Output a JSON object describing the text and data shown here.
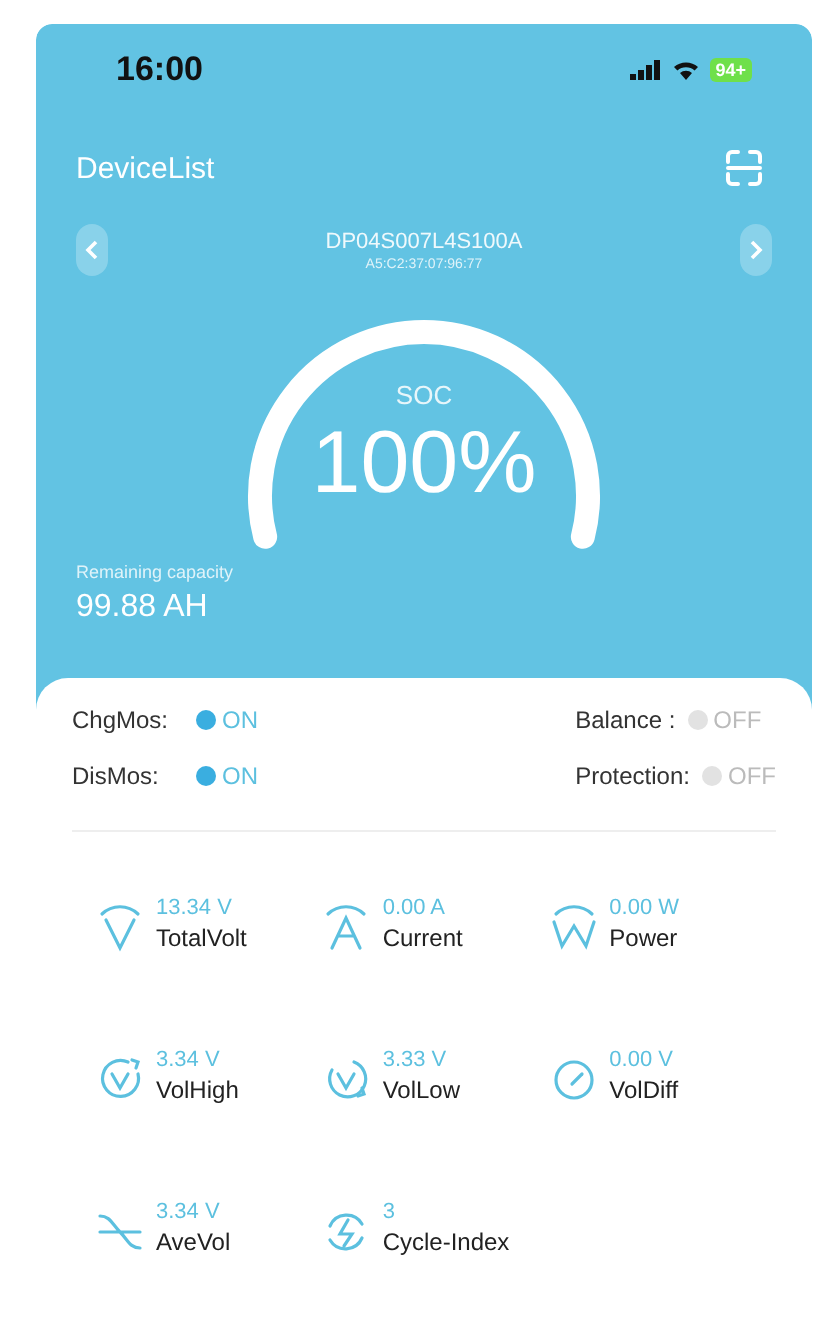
{
  "status_bar": {
    "time": "16:00",
    "battery": "94+"
  },
  "header": {
    "title": "DeviceList"
  },
  "device": {
    "name": "DP04S007L4S100A",
    "mac": "A5:C2:37:07:96:77"
  },
  "gauge": {
    "label": "SOC",
    "value": "100%"
  },
  "capacity": {
    "label": "Remaining capacity",
    "value": "99.88 AH"
  },
  "states": [
    {
      "label": "ChgMos:",
      "value": "ON",
      "on": true
    },
    {
      "label": "Balance :",
      "value": "OFF",
      "on": false
    },
    {
      "label": "DisMos:",
      "value": "ON",
      "on": true
    },
    {
      "label": "Protection:",
      "value": "OFF",
      "on": false
    }
  ],
  "metrics": [
    {
      "kind": "volt",
      "value": "13.34 V",
      "label": "TotalVolt"
    },
    {
      "kind": "current",
      "value": "0.00 A",
      "label": "Current"
    },
    {
      "kind": "power",
      "value": "0.00 W",
      "label": "Power"
    },
    {
      "kind": "vol-high",
      "value": "3.34 V",
      "label": "VolHigh"
    },
    {
      "kind": "vol-low",
      "value": "3.33 V",
      "label": "VolLow"
    },
    {
      "kind": "vol-diff",
      "value": "0.00 V",
      "label": "VolDiff"
    },
    {
      "kind": "ave-vol",
      "value": "3.34 V",
      "label": "AveVol"
    },
    {
      "kind": "cycle",
      "value": "3",
      "label": "Cycle-Index"
    }
  ]
}
